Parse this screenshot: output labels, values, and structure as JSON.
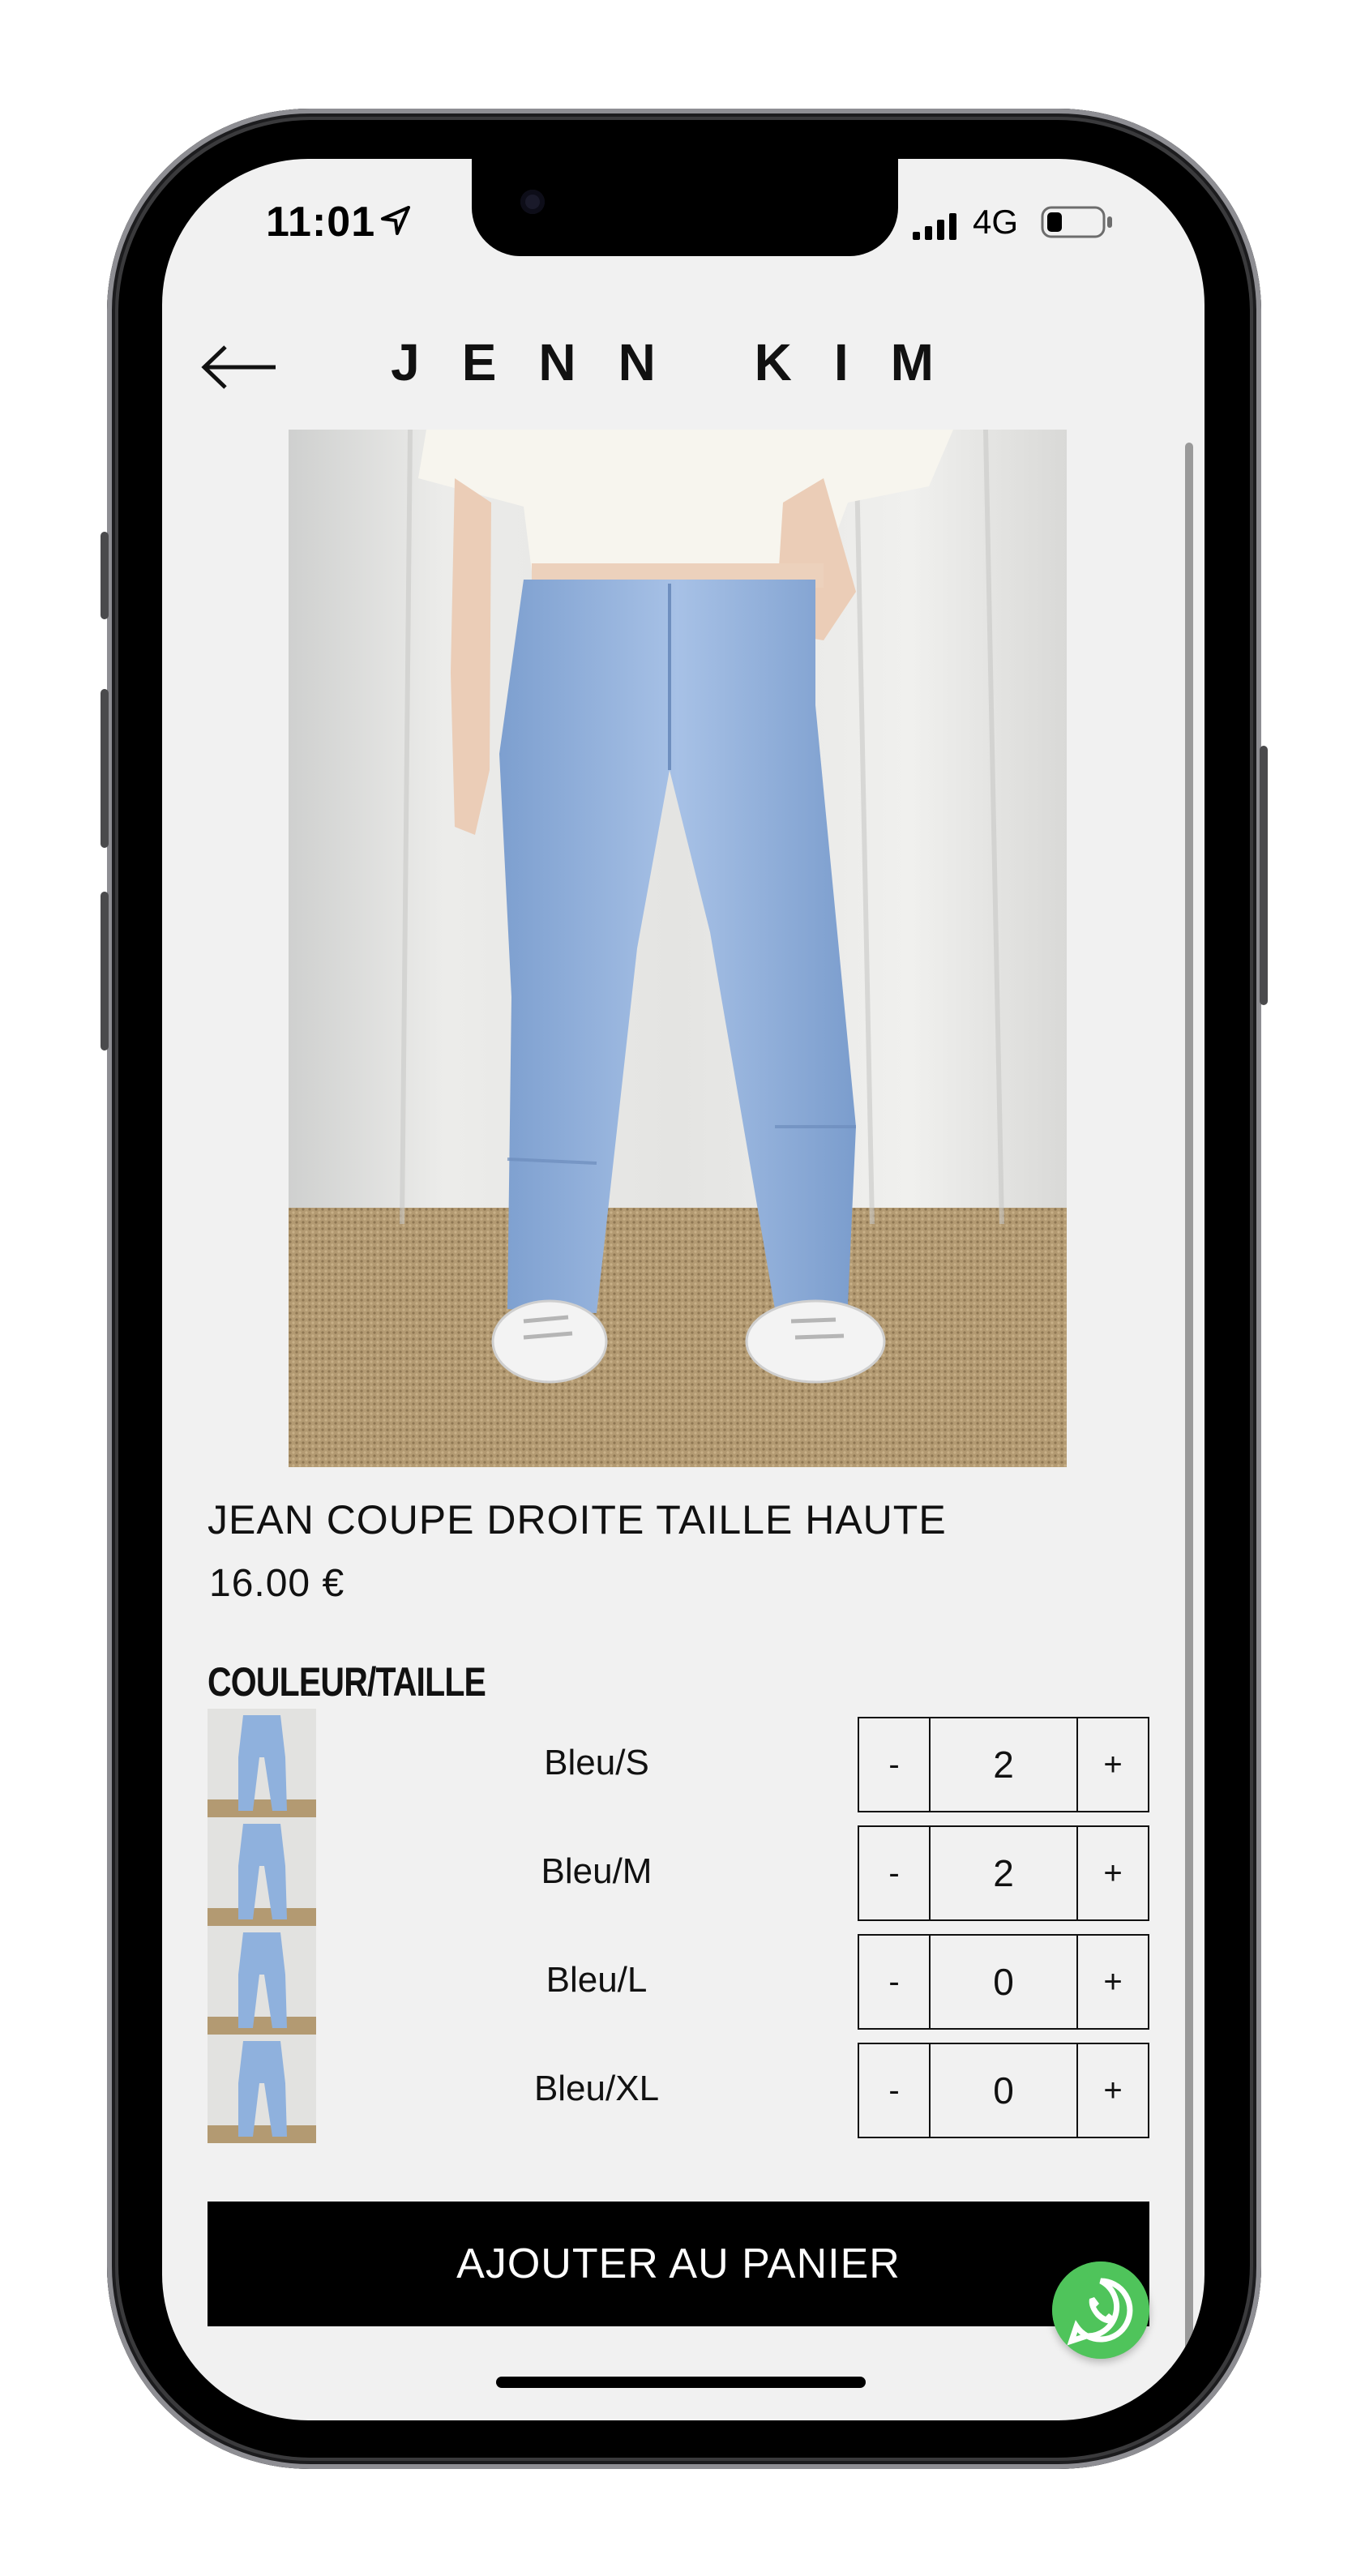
{
  "status_bar": {
    "time": "11:01",
    "network": "4G"
  },
  "header": {
    "brand": "JENN KIM"
  },
  "product": {
    "title": "JEAN COUPE DROITE TAILLE HAUTE",
    "price": "16.00 €",
    "section_label": "COULEUR/TAILLE",
    "variants": [
      {
        "label": "Bleu/S",
        "quantity": "2"
      },
      {
        "label": "Bleu/M",
        "quantity": "2"
      },
      {
        "label": "Bleu/L",
        "quantity": "0"
      },
      {
        "label": "Bleu/XL",
        "quantity": "0"
      }
    ],
    "minus_label": "-",
    "plus_label": "+"
  },
  "cta": {
    "add_to_cart": "AJOUTER AU PANIER"
  },
  "colors": {
    "screen_bg": "#f1f1f1",
    "button_bg": "#000000",
    "whatsapp": "#4fc45b",
    "denim": "#8fb1dd"
  },
  "icons": [
    "back-arrow-icon",
    "location-arrow-icon",
    "signal-icon",
    "battery-icon",
    "whatsapp-icon"
  ]
}
